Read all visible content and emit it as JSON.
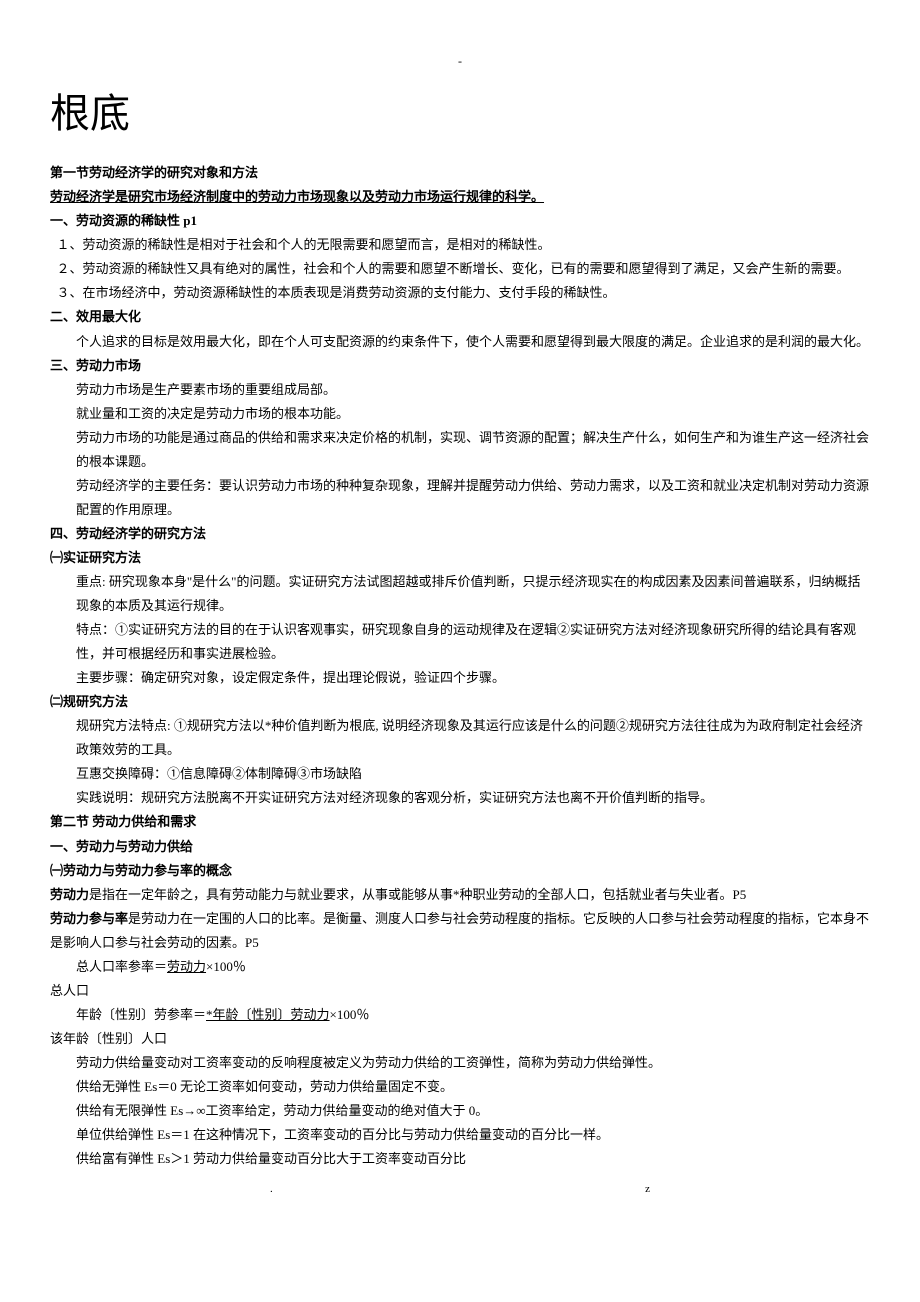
{
  "top_dash": "-",
  "title": "根底",
  "s1_header": "第一节劳动经济学的研究对象和方法",
  "s1_def": "劳动经济学是研究市场经济制度中的劳动力市场现象以及劳动力市场运行规律的科学。",
  "h1": "一、劳动资源的稀缺性   p1",
  "h1_p1": "１、劳动资源的稀缺性是相对于社会和个人的无限需要和愿望而言，是相对的稀缺性。",
  "h1_p2": "２、劳动资源的稀缺性又具有绝对的属性，社会和个人的需要和愿望不断增长、变化，已有的需要和愿望得到了满足，又会产生新的需要。",
  "h1_p3": "３、在市场经济中，劳动资源稀缺性的本质表现是消费劳动资源的支付能力、支付手段的稀缺性。",
  "h2": "二、效用最大化",
  "h2_p1": "个人追求的目标是效用最大化，即在个人可支配资源的约束条件下，使个人需要和愿望得到最大限度的满足。企业追求的是利润的最大化。",
  "h3": "三、劳动力市场",
  "h3_p1": "劳动力市场是生产要素市场的重要组成局部。",
  "h3_p2": "就业量和工资的决定是劳动力市场的根本功能。",
  "h3_p3": "劳动力市场的功能是通过商品的供给和需求来决定价格的机制，实现、调节资源的配置；解决生产什么，如何生产和为谁生产这一经济社会的根本课题。",
  "h3_p4": "劳动经济学的主要任务：要认识劳动力市场的种种复杂现象，理解并提醒劳动力供给、劳动力需求，以及工资和就业决定机制对劳动力资源配置的作用原理。",
  "h4": "四、劳动经济学的研究方法",
  "m1": "㈠实证研究方法",
  "m1_p1": "重点: 研究现象本身\"是什么\"的问题。实证研究方法试图超越或排斥价值判断，只提示经济现实在的构成因素及因素间普遍联系，归纳概括现象的本质及其运行规律。",
  "m1_p2": "特点：①实证研究方法的目的在于认识客观事实，研究现象自身的运动规律及在逻辑②实证研究方法对经济现象研究所得的结论具有客观性，并可根据经历和事实进展检验。",
  "m1_p3": "主要步骤：确定研究对象，设定假定条件，提出理论假说，验证四个步骤。",
  "m2": "㈡规研究方法",
  "m2_p1": "规研究方法特点: ①规研究方法以*种价值判断为根底, 说明经济现象及其运行应该是什么的问题②规研究方法往往成为为政府制定社会经济政策效劳的工具。",
  "m2_p2": "互惠交换障碍：①信息障碍②体制障碍③市场缺陷",
  "m2_p3": "实践说明：规研究方法脱离不开实证研究方法对经济现象的客观分析，实证研究方法也离不开价值判断的指导。",
  "s2_header": "第二节   劳动力供给和需求",
  "s2_h1": "一、劳动力与劳动力供给",
  "s2_m1": "㈠劳动力与劳动力参与率的概念",
  "def_ldl_b": "劳动力",
  "def_ldl_t": "是指在一定年龄之，具有劳动能力与就业要求，从事或能够从事*种职业劳动的全部人口，包括就业者与失业者。P5",
  "def_cyl_b": "劳动力参与率",
  "def_cyl_t": "是劳动力在一定围的人口的比率。是衡量、测度人口参与社会劳动程度的指标。它反映的人口参与社会劳动程度的指标，它本身不是影响人口参与社会劳动的因素。P5",
  "formula1_a": "总人口率参率＝",
  "formula1_u": "劳动力",
  "formula1_b": "×100％",
  "pop": "总人口",
  "formula2_a": "年龄〔性别〕劳参率＝",
  "formula2_u": "*年龄〔性别〕劳动力",
  "formula2_b": "×100％",
  "pop2": "该年龄〔性别〕人口",
  "elastic_def": "劳动力供给量变动对工资率变动的反响程度被定义为劳动力供给的工资弹性，简称为劳动力供给弹性。",
  "e0": "供给无弹性 Es＝0 无论工资率如何变动，劳动力供给量固定不变。",
  "einf": "供给有无限弹性 Es→∞工资率给定，劳动力供给量变动的绝对值大于 0。",
  "e1": "单位供给弹性 Es＝1 在这种情况下，工资率变动的百分比与劳动力供给量变动的百分比一样。",
  "egt1": "供给富有弹性 Es＞1 劳动力供给量变动百分比大于工资率变动百分比",
  "foot_l": ".",
  "foot_r": "z"
}
